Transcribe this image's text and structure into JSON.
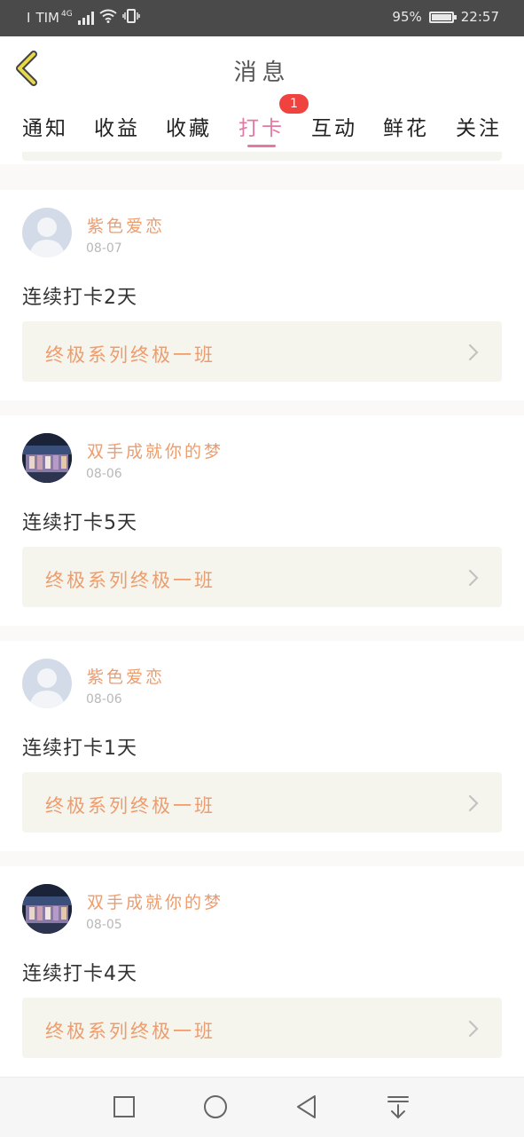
{
  "status_bar": {
    "carrier": "TIM",
    "network": "4G",
    "battery": "95%",
    "time": "22:57"
  },
  "header": {
    "title": "消息",
    "back_icon": "chevron-left-icon"
  },
  "tabs": [
    {
      "label": "通知",
      "active": false
    },
    {
      "label": "收益",
      "active": false
    },
    {
      "label": "收藏",
      "active": false
    },
    {
      "label": "打卡",
      "active": true,
      "badge": "1"
    },
    {
      "label": "互动",
      "active": false
    },
    {
      "label": "鲜花",
      "active": false
    },
    {
      "label": "关注",
      "active": false
    }
  ],
  "feed": [
    {
      "user": "紫色爱恋",
      "date": "08-07",
      "text": "连续打卡2天",
      "course": "终极系列终极一班",
      "avatar": "default-avatar"
    },
    {
      "user": "双手成就你的梦",
      "date": "08-06",
      "text": "连续打卡5天",
      "course": "终极系列终极一班",
      "avatar": "photo-avatar"
    },
    {
      "user": "紫色爱恋",
      "date": "08-06",
      "text": "连续打卡1天",
      "course": "终极系列终极一班",
      "avatar": "default-avatar"
    },
    {
      "user": "双手成就你的梦",
      "date": "08-05",
      "text": "连续打卡4天",
      "course": "终极系列终极一班",
      "avatar": "photo-avatar"
    }
  ],
  "colors": {
    "accent_pink": "#e17aa2",
    "orange_text": "#ef9c6c",
    "badge_red": "#f0423f",
    "back_yellow": "#e8d94a"
  },
  "nav_bar": [
    "square-icon",
    "circle-icon",
    "triangle-back-icon",
    "pull-down-icon"
  ]
}
